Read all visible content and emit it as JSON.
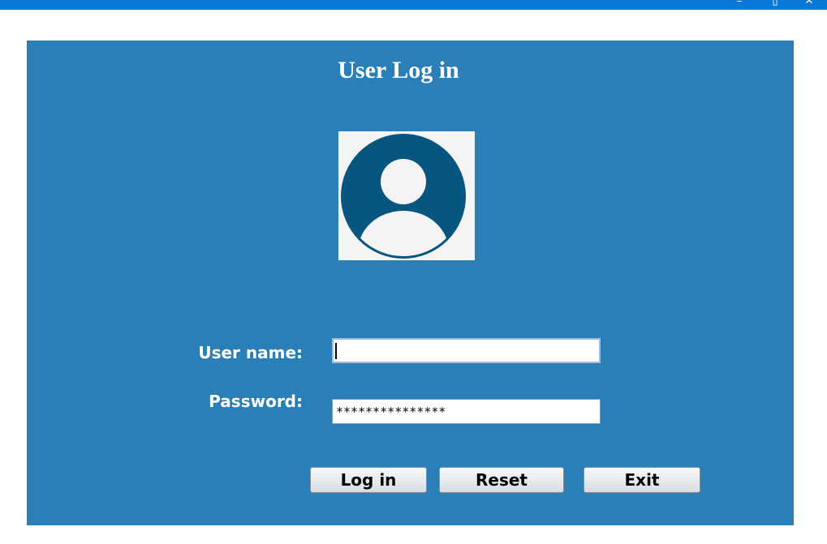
{
  "window": {
    "minimize_glyph": "–",
    "maximize_glyph": "▯",
    "close_glyph": "✕"
  },
  "form": {
    "title": "User Log in",
    "avatar_icon": "user-avatar-icon",
    "username_label": "User name:",
    "username_value": "",
    "password_label": "Password:",
    "password_value": "***************",
    "login_label": "Log in",
    "reset_label": "Reset",
    "exit_label": "Exit"
  },
  "colors": {
    "titlebar": "#0a78d4",
    "panel": "#2b7fb7",
    "avatar_fg": "#075680",
    "avatar_bg": "#f4f4f4"
  }
}
